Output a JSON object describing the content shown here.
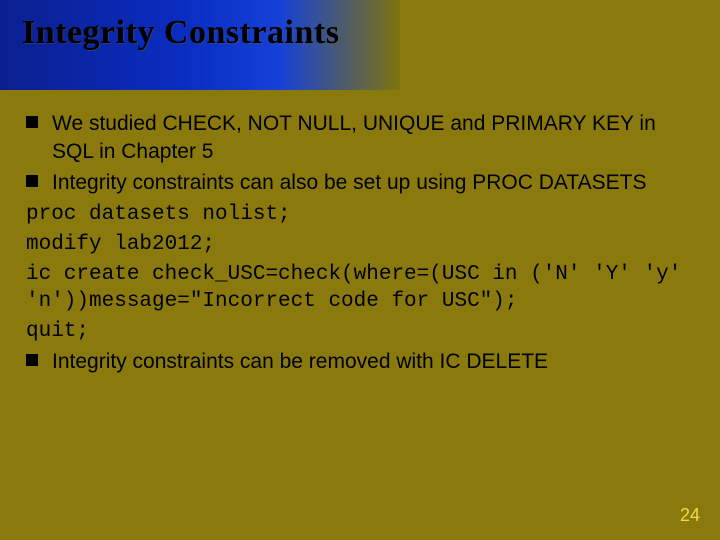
{
  "slide": {
    "title": "Integrity Constraints",
    "bullets": [
      "We studied CHECK, NOT NULL, UNIQUE and PRIMARY KEY in SQL in Chapter 5",
      "Integrity constraints can also be set up using PROC DATASETS",
      "Integrity constraints can be removed with IC DELETE"
    ],
    "code_lines": [
      "proc datasets nolist;",
      "modify lab2012;",
      "ic create check_USC=check(where=(USC in ('N' 'Y' 'y' 'n'))message=\"Incorrect code for USC\");",
      "quit;"
    ],
    "page_number": "24"
  }
}
